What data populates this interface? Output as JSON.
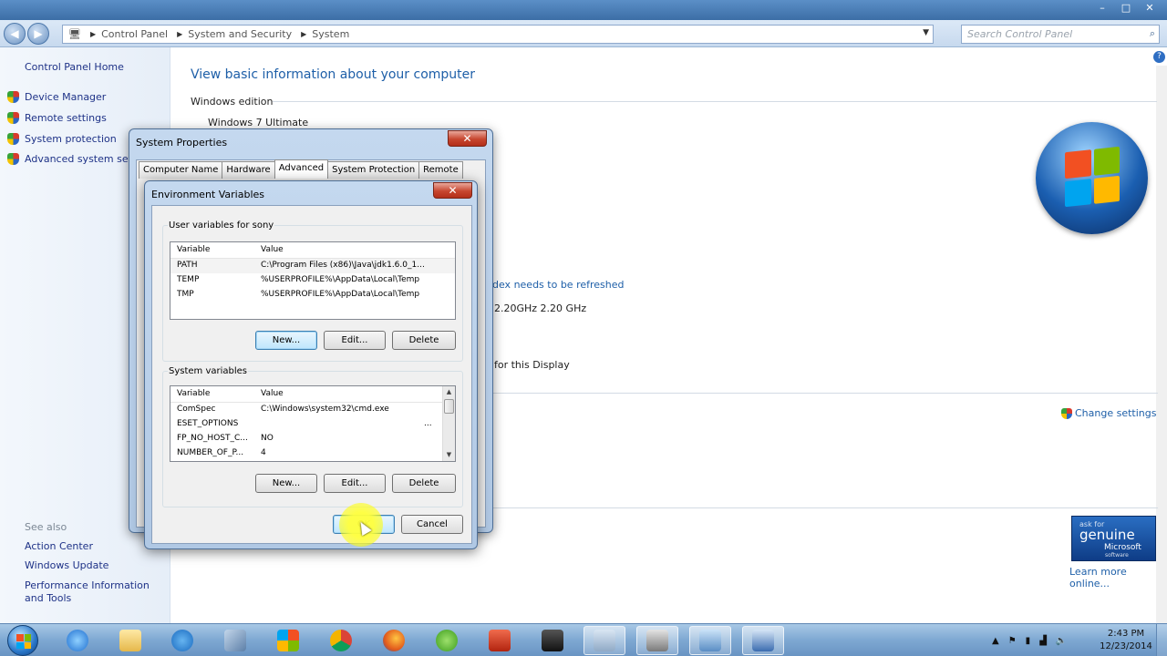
{
  "window": {
    "minimize": "–",
    "maximize": "□",
    "close": "✕"
  },
  "address": {
    "crumbs": [
      "Control Panel",
      "System and Security",
      "System"
    ],
    "search_placeholder": "Search Control Panel"
  },
  "leftnav": {
    "home": "Control Panel Home",
    "links": [
      "Device Manager",
      "Remote settings",
      "System protection",
      "Advanced system settings"
    ],
    "see_also": "See also",
    "see_also_links": [
      "Action Center",
      "Windows Update",
      "Performance Information and Tools"
    ]
  },
  "main": {
    "title": "View basic information about your computer",
    "section_edition": "Windows edition",
    "edition": "Windows 7 Ultimate",
    "refresh_link": "dex needs to be refreshed",
    "cpu": "2.20GHz   2.20 GHz",
    "display": "for this Display",
    "change_settings": "Change settings",
    "learn_more": "Learn more online...",
    "genuine_line1": "ask for",
    "genuine_line2": "genuine",
    "genuine_line3": "Microsoft",
    "genuine_line4": "software"
  },
  "system_properties": {
    "title": "System Properties",
    "tabs": [
      "Computer Name",
      "Hardware",
      "Advanced",
      "System Protection",
      "Remote"
    ],
    "active_tab": "Advanced"
  },
  "env_vars": {
    "title": "Environment Variables",
    "user_group_label": "User variables for sony",
    "system_group_label": "System variables",
    "col_variable": "Variable",
    "col_value": "Value",
    "user_vars": [
      {
        "variable": "PATH",
        "value": "C:\\Program Files (x86)\\Java\\jdk1.6.0_1..."
      },
      {
        "variable": "TEMP",
        "value": "%USERPROFILE%\\AppData\\Local\\Temp"
      },
      {
        "variable": "TMP",
        "value": "%USERPROFILE%\\AppData\\Local\\Temp"
      }
    ],
    "system_vars": [
      {
        "variable": "ComSpec",
        "value": "C:\\Windows\\system32\\cmd.exe"
      },
      {
        "variable": "ESET_OPTIONS",
        "value": "..."
      },
      {
        "variable": "FP_NO_HOST_C...",
        "value": "NO"
      },
      {
        "variable": "NUMBER_OF_P...",
        "value": "4"
      }
    ],
    "btn_new": "New...",
    "btn_edit": "Edit...",
    "btn_delete": "Delete",
    "btn_ok": "OK",
    "btn_cancel": "Cancel"
  },
  "taskbar": {
    "time": "2:43 PM",
    "date": "12/23/2014"
  },
  "colors": {
    "link": "#1e5fa8",
    "nav_link": "#1e3287",
    "flag_red": "#f25022",
    "flag_green": "#7fba00",
    "flag_blue": "#00a4ef",
    "flag_yellow": "#ffb900"
  }
}
